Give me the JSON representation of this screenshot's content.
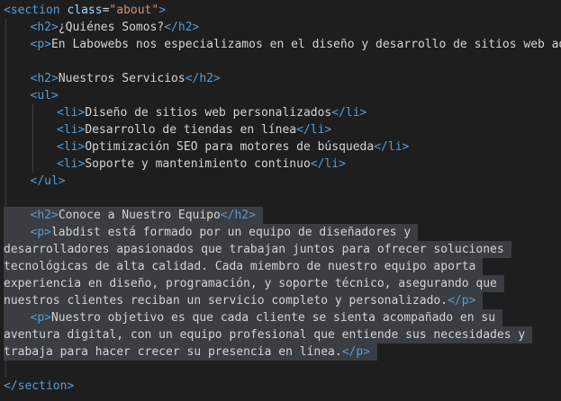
{
  "lines": [
    {
      "indent": 0,
      "tokens": [
        {
          "t": "<section ",
          "c": "tag"
        },
        {
          "t": "class",
          "c": "attr"
        },
        {
          "t": "=",
          "c": "txt"
        },
        {
          "t": "\"about\"",
          "c": "str"
        },
        {
          "t": ">",
          "c": "tag"
        }
      ]
    },
    {
      "indent": 1,
      "tokens": [
        {
          "t": "<h2>",
          "c": "tag"
        },
        {
          "t": "¿Quiénes Somos?",
          "c": "txt"
        },
        {
          "t": "</h2>",
          "c": "tag"
        }
      ]
    },
    {
      "indent": 1,
      "tokens": [
        {
          "t": "<p>",
          "c": "tag"
        },
        {
          "t": "En Labowebs nos especializamos en el diseño y desarrollo de sitios web adap",
          "c": "txt"
        }
      ]
    },
    {
      "indent": 0,
      "tokens": []
    },
    {
      "indent": 1,
      "tokens": [
        {
          "t": "<h2>",
          "c": "tag"
        },
        {
          "t": "Nuestros Servicios",
          "c": "txt"
        },
        {
          "t": "</h2>",
          "c": "tag"
        }
      ]
    },
    {
      "indent": 1,
      "tokens": [
        {
          "t": "<ul>",
          "c": "tag"
        }
      ]
    },
    {
      "indent": 2,
      "tokens": [
        {
          "t": "<li>",
          "c": "tag"
        },
        {
          "t": "Diseño de sitios web personalizados",
          "c": "txt"
        },
        {
          "t": "</li>",
          "c": "tag"
        }
      ]
    },
    {
      "indent": 2,
      "tokens": [
        {
          "t": "<li>",
          "c": "tag"
        },
        {
          "t": "Desarrollo de tiendas en línea",
          "c": "txt"
        },
        {
          "t": "</li>",
          "c": "tag"
        }
      ]
    },
    {
      "indent": 2,
      "tokens": [
        {
          "t": "<li>",
          "c": "tag"
        },
        {
          "t": "Optimización SEO para motores de búsqueda",
          "c": "txt"
        },
        {
          "t": "</li>",
          "c": "tag"
        }
      ]
    },
    {
      "indent": 2,
      "tokens": [
        {
          "t": "<li>",
          "c": "tag"
        },
        {
          "t": "Soporte y mantenimiento continuo",
          "c": "txt"
        },
        {
          "t": "</li>",
          "c": "tag"
        }
      ]
    },
    {
      "indent": 1,
      "tokens": [
        {
          "t": "</ul>",
          "c": "tag"
        }
      ]
    },
    {
      "indent": 0,
      "tokens": []
    },
    {
      "indent": 1,
      "selected": true,
      "tokens": [
        {
          "t": "<h2>",
          "c": "tag"
        },
        {
          "t": "Conoce a Nuestro Equipo",
          "c": "txt"
        },
        {
          "t": "</h2>",
          "c": "tag"
        }
      ]
    },
    {
      "indent": 1,
      "selected": true,
      "tokens": [
        {
          "t": "<p>",
          "c": "tag"
        },
        {
          "t": "labdist está formado por un equipo de diseñadores y",
          "c": "txt"
        }
      ]
    },
    {
      "indent": 0,
      "selected": true,
      "tokens": [
        {
          "t": "desarrolladores apasionados que trabajan juntos para ofrecer soluciones",
          "c": "txt"
        }
      ]
    },
    {
      "indent": 0,
      "selected": true,
      "tokens": [
        {
          "t": "tecnológicas de alta calidad. Cada miembro de nuestro equipo aporta",
          "c": "txt"
        }
      ]
    },
    {
      "indent": 0,
      "selected": true,
      "tokens": [
        {
          "t": "experiencia en diseño, programación, y soporte técnico, asegurando que",
          "c": "txt"
        }
      ]
    },
    {
      "indent": 0,
      "selected": true,
      "tokens": [
        {
          "t": "nuestros clientes reciban un servicio completo y personalizado.",
          "c": "txt"
        },
        {
          "t": "</p>",
          "c": "tag"
        }
      ]
    },
    {
      "indent": 1,
      "selected": true,
      "tokens": [
        {
          "t": "<p>",
          "c": "tag"
        },
        {
          "t": "Nuestro objetivo es que cada cliente se sienta acompañado en su",
          "c": "txt"
        }
      ]
    },
    {
      "indent": 0,
      "selected": true,
      "tokens": [
        {
          "t": "aventura digital, con un equipo profesional que entiende sus necesidades y",
          "c": "txt"
        }
      ]
    },
    {
      "indent": 0,
      "selected": true,
      "tokens": [
        {
          "t": "trabaja para hacer crecer su presencia en línea.",
          "c": "txt"
        },
        {
          "t": "</p>",
          "c": "tag"
        }
      ]
    },
    {
      "indent": 0,
      "tokens": []
    },
    {
      "indent": 0,
      "tokens": [
        {
          "t": "</section>",
          "c": "tag"
        }
      ]
    }
  ]
}
